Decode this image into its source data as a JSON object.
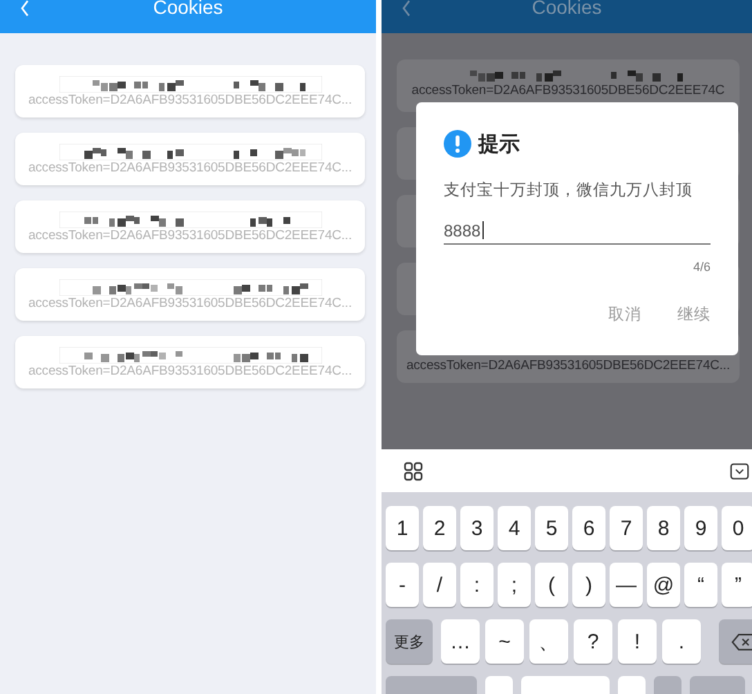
{
  "left_screen": {
    "header": {
      "title": "Cookies"
    },
    "cookies": [
      {
        "token": "accessToken=D2A6AFB93531605DBE56DC2EEE74C..."
      },
      {
        "token": "accessToken=D2A6AFB93531605DBE56DC2EEE74C..."
      },
      {
        "token": "accessToken=D2A6AFB93531605DBE56DC2EEE74C..."
      },
      {
        "token": "accessToken=D2A6AFB93531605DBE56DC2EEE74C..."
      },
      {
        "token": "accessToken=D2A6AFB93531605DBE56DC2EEE74C..."
      }
    ]
  },
  "right_screen": {
    "header": {
      "title": "Cookies"
    },
    "cookies": [
      {
        "kind": "visible",
        "token": "accessToken=D2A6AFB93531605DBE56DC2EEE74C"
      },
      {
        "kind": "covered"
      },
      {
        "kind": "covered"
      },
      {
        "kind": "covered"
      },
      {
        "kind": "visible",
        "token": "accessToken=D2A6AFB93531605DBE56DC2EEE74C..."
      }
    ],
    "dialog": {
      "title": "提示",
      "message": "支付宝十万封顶，微信九万八封顶",
      "input": {
        "value": "8888"
      },
      "counter": "4/6",
      "buttons": [
        "取消",
        "继续"
      ]
    },
    "keyboard": {
      "rows": [
        [
          {
            "kind": "char",
            "label": "1"
          },
          {
            "kind": "char",
            "label": "2"
          },
          {
            "kind": "char",
            "label": "3"
          },
          {
            "kind": "char",
            "label": "4"
          },
          {
            "kind": "char",
            "label": "5"
          },
          {
            "kind": "char",
            "label": "6"
          },
          {
            "kind": "char",
            "label": "7"
          },
          {
            "kind": "char",
            "label": "8"
          },
          {
            "kind": "char",
            "label": "9"
          },
          {
            "kind": "char",
            "label": "0"
          }
        ],
        [
          {
            "kind": "char",
            "label": "-"
          },
          {
            "kind": "char",
            "label": "/"
          },
          {
            "kind": "char",
            "label": ":"
          },
          {
            "kind": "char",
            "label": ";"
          },
          {
            "kind": "char",
            "label": "("
          },
          {
            "kind": "char",
            "label": ")"
          },
          {
            "kind": "char",
            "label": "—"
          },
          {
            "kind": "char",
            "label": "@"
          },
          {
            "kind": "char",
            "label": "“"
          },
          {
            "kind": "char",
            "label": "”"
          }
        ],
        [
          {
            "kind": "function",
            "label": "更多"
          },
          {
            "kind": "char",
            "label": "…"
          },
          {
            "kind": "char",
            "label": "~"
          },
          {
            "kind": "char",
            "label": "、"
          },
          {
            "kind": "char",
            "label": "?"
          },
          {
            "kind": "char",
            "label": "!"
          },
          {
            "kind": "char",
            "label": "."
          },
          {
            "kind": "backspace"
          }
        ]
      ]
    }
  }
}
